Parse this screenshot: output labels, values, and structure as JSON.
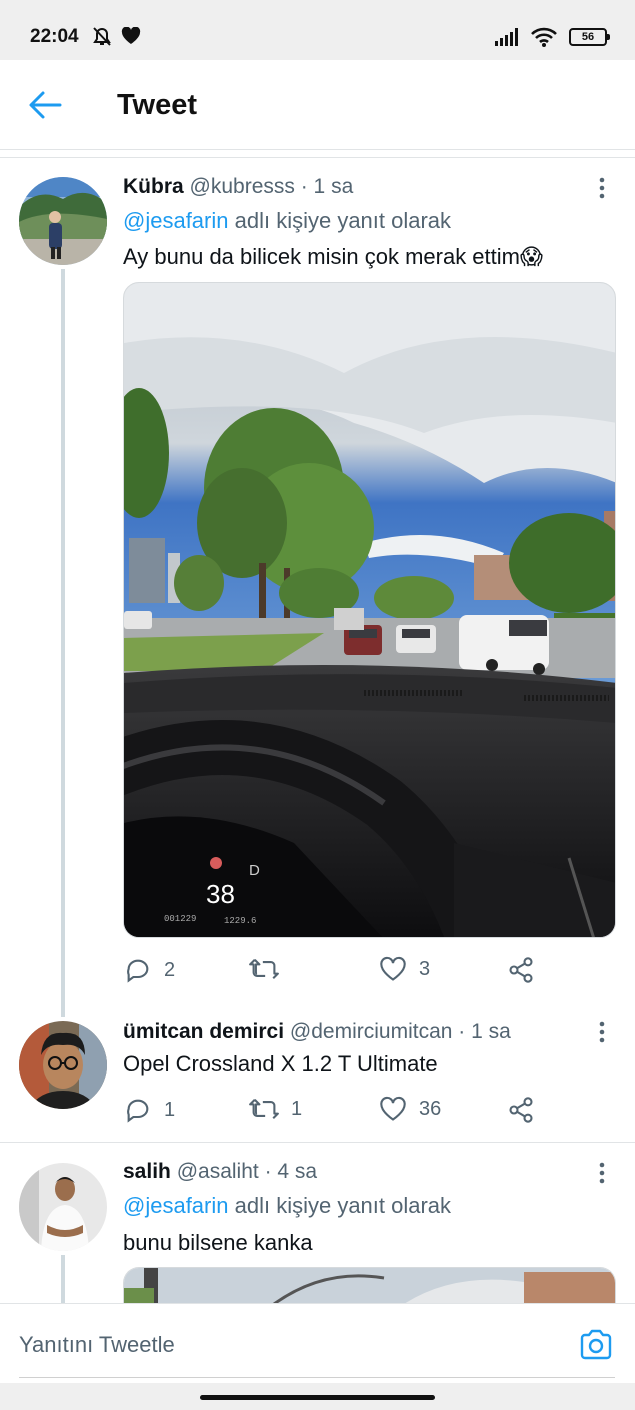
{
  "status_bar": {
    "time": "22:04",
    "battery": "56"
  },
  "header": {
    "title": "Tweet"
  },
  "tweets": [
    {
      "name": "Kübra",
      "handle": "@kubresss",
      "time": "· 1 sa",
      "reply_to_mention": "@jesafarin",
      "reply_to_suffix": " adlı kişiye yanıt olarak",
      "text": "Ay bunu da bilicek misin çok merak ettim😱",
      "media": {
        "speedometer": "38",
        "odometer": "001229",
        "trip": "1229.6",
        "gear": "D"
      },
      "replies": "2",
      "retweets": "",
      "likes": "3"
    },
    {
      "name": "ümitcan demirci",
      "handle": "@demirciumitcan",
      "time": "· 1 sa",
      "text": "Opel Crossland X 1.2 T Ultimate",
      "replies": "1",
      "retweets": "1",
      "likes": "36"
    },
    {
      "name": "salih",
      "handle": "@asaliht",
      "time": "· 4 sa",
      "reply_to_mention": "@jesafarin",
      "reply_to_suffix": " adlı kişiye yanıt olarak",
      "text": "bunu bilsene kanka"
    }
  ],
  "composer": {
    "placeholder": "Yanıtını Tweetle"
  },
  "icons": {
    "back": "arrow-left-icon",
    "more": "more-vertical-icon",
    "reply": "reply-icon",
    "retweet": "retweet-icon",
    "like": "heart-icon",
    "share": "share-icon",
    "camera": "camera-icon"
  },
  "colors": {
    "accent": "#1d9bf0",
    "secondary_text": "#536471",
    "divider": "#e1e4e6"
  }
}
